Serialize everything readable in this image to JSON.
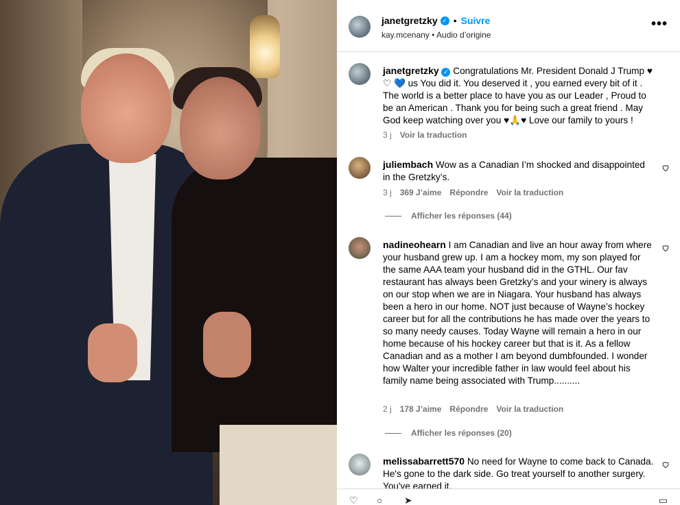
{
  "post": {
    "author": "janetgretzky",
    "follow_label": "Suivre",
    "audio_user": "kay.mcenany",
    "audio_label": "Audio d’origine",
    "more_label": "•••"
  },
  "caption": {
    "username": "janetgretzky",
    "text": "Congratulations Mr. President Donald J Trump ♥ ♡ 💙 us You did it. You deserved it , you earned every bit of it . The world is a better place to have you as our Leader , Proud to be an American . Thank you for being such a great friend . May God keep watching over you ♥🙏♥ Love our family to yours !",
    "time": "3 j",
    "translate": "Voir la traduction"
  },
  "comments": [
    {
      "username": "juliembach",
      "text": "Wow as a Canadian I’m shocked and disappointed in the Gretzky’s.",
      "time": "3 j",
      "likes": "369 J’aime",
      "reply": "Répondre",
      "translate": "Voir la traduction",
      "view_replies": "Afficher les réponses (44)"
    },
    {
      "username": "nadineohearn",
      "text": "I am Canadian and live an hour away from where your husband grew up. I am a hockey mom, my son played for the same AAA team your husband did in the GTHL. Our fav restaurant has always been Gretzky’s and your winery is always on our stop when we are in Niagara. Your husband has always been a hero in our home. NOT just because of Wayne’s hockey career but for all the contributions he has made over the years to so many needy causes. Today Wayne will remain a hero in our home because of his hockey career but that is it. As a fellow Canadian and as a mother I am beyond dumbfounded. I wonder how Walter your incredible father in law would feel about his family name being associated with Trump..........",
      "time": "2 j",
      "likes": "178 J’aime",
      "reply": "Répondre",
      "translate": "Voir la traduction",
      "view_replies": "Afficher les réponses (20)"
    },
    {
      "username": "melissabarrett570",
      "text": "No need for Wayne to come back to Canada. He's gone to the dark side. Go treat yourself to another surgery. You've earned it."
    }
  ],
  "icons": {
    "verified": "verified-badge-icon",
    "heart": "heart-outline-icon",
    "more": "more-horizontal-icon"
  },
  "colors": {
    "accent": "#0095f6",
    "muted": "#737373",
    "divider": "#dbdbdb"
  }
}
